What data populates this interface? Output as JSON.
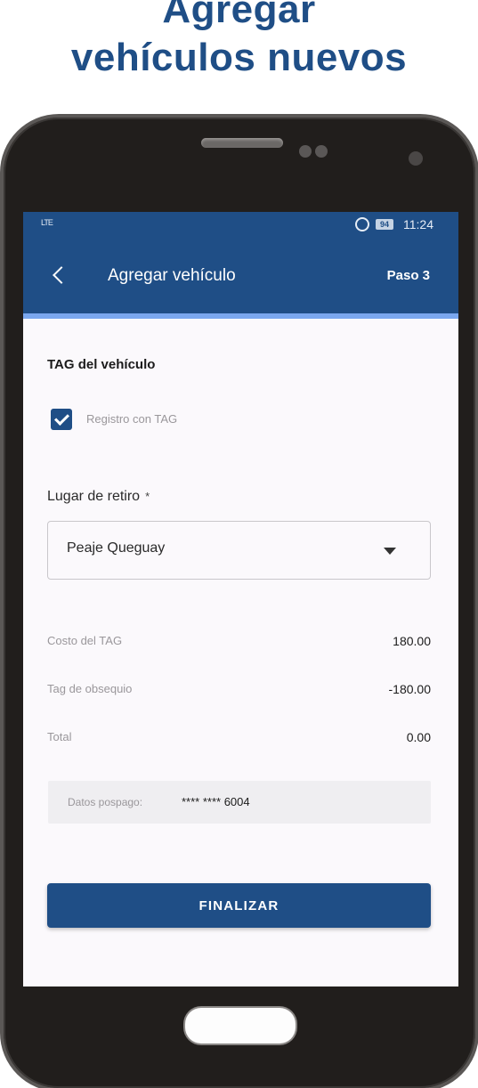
{
  "promo": {
    "line1": "Agregar",
    "line2": "vehículos nuevos"
  },
  "status_bar": {
    "signal": "LTE",
    "battery": "94",
    "time": "11:24"
  },
  "app_bar": {
    "title": "Agregar vehículo",
    "step": "Paso 3"
  },
  "tag_section": {
    "title": "TAG del vehículo",
    "checkbox_label": "Registro con TAG",
    "checked": true
  },
  "pickup": {
    "label": "Lugar de retiro",
    "required_mark": "*",
    "selected": "Peaje Queguay"
  },
  "costs": [
    {
      "label": "Costo del TAG",
      "value": "180.00"
    },
    {
      "label": "Tag de obsequio",
      "value": "-180.00"
    },
    {
      "label": "Total",
      "value": "0.00"
    }
  ],
  "postpaid": {
    "label": "Datos pospago:",
    "value": "**** **** 6004"
  },
  "actions": {
    "finish_label": "FINALIZAR"
  },
  "colors": {
    "brand": "#1f4e86",
    "accent_underline": "#7aa7ee",
    "screen_bg": "#fbf9fc",
    "phone_body": "#211e1c"
  },
  "icons": [
    "signal-icon",
    "alarm-icon",
    "battery-icon",
    "back-arrow-icon",
    "checkbox-checked-icon",
    "dropdown-arrow-icon"
  ]
}
